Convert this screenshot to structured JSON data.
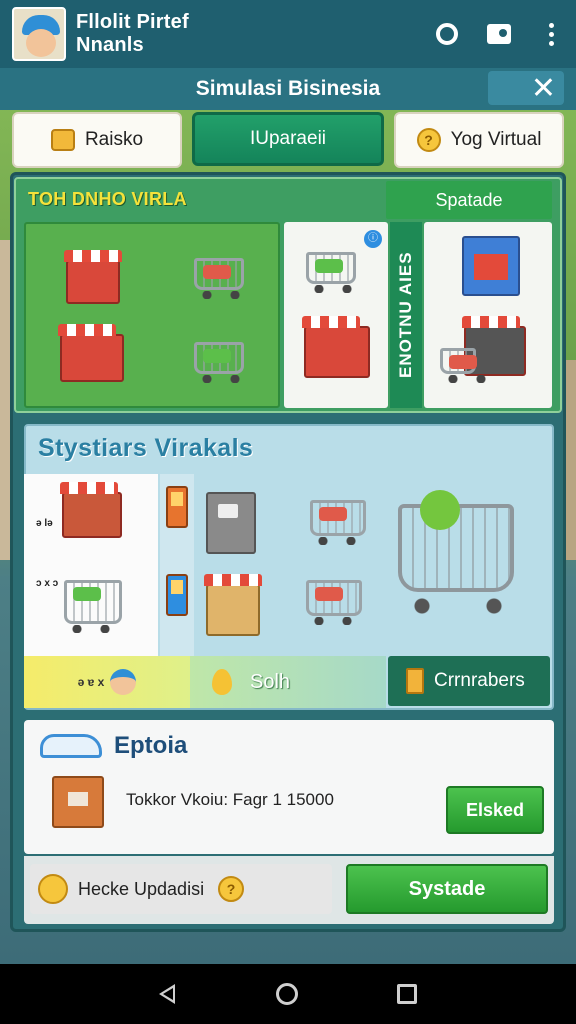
{
  "header": {
    "title_line1": "Fllolit Pirtef",
    "title_line2": "Nnanls",
    "icons": [
      "timer-icon",
      "camera-icon",
      "more-icon"
    ]
  },
  "titlebar": {
    "title": "Simulasi Bisinesia",
    "close_glyph": "✕"
  },
  "tabs": [
    {
      "label": "Raisko"
    },
    {
      "label": "IUparaeii"
    },
    {
      "label": "Yog Virtual"
    }
  ],
  "section1": {
    "heading": "TOH DNHO VIRLA",
    "button": "Spatade",
    "vertical_label": "ENOTNU AIES"
  },
  "section2": {
    "heading": "Stystiars Virakals",
    "left_nums": [
      "ǝ lǝ",
      "ɔ x ɔ"
    ],
    "strip_label": "ǝ ɐ x",
    "mid_label": "Solh",
    "right_label": "Crrnrabers"
  },
  "section3": {
    "heading": "Eptoia",
    "detail": "Tokkor Vkoiu: Fagr 1 15000",
    "action_button": "Elsked",
    "footer_label": "Hecke Updadisi",
    "footer_button": "Systade"
  },
  "colors": {
    "appbar": "#1f5f6f",
    "accent_green": "#259a2e",
    "heading_blue": "#2a7fa2",
    "label_yellow": "#f5e23a"
  },
  "navigation": [
    "back-icon",
    "home-icon",
    "recents-icon"
  ]
}
